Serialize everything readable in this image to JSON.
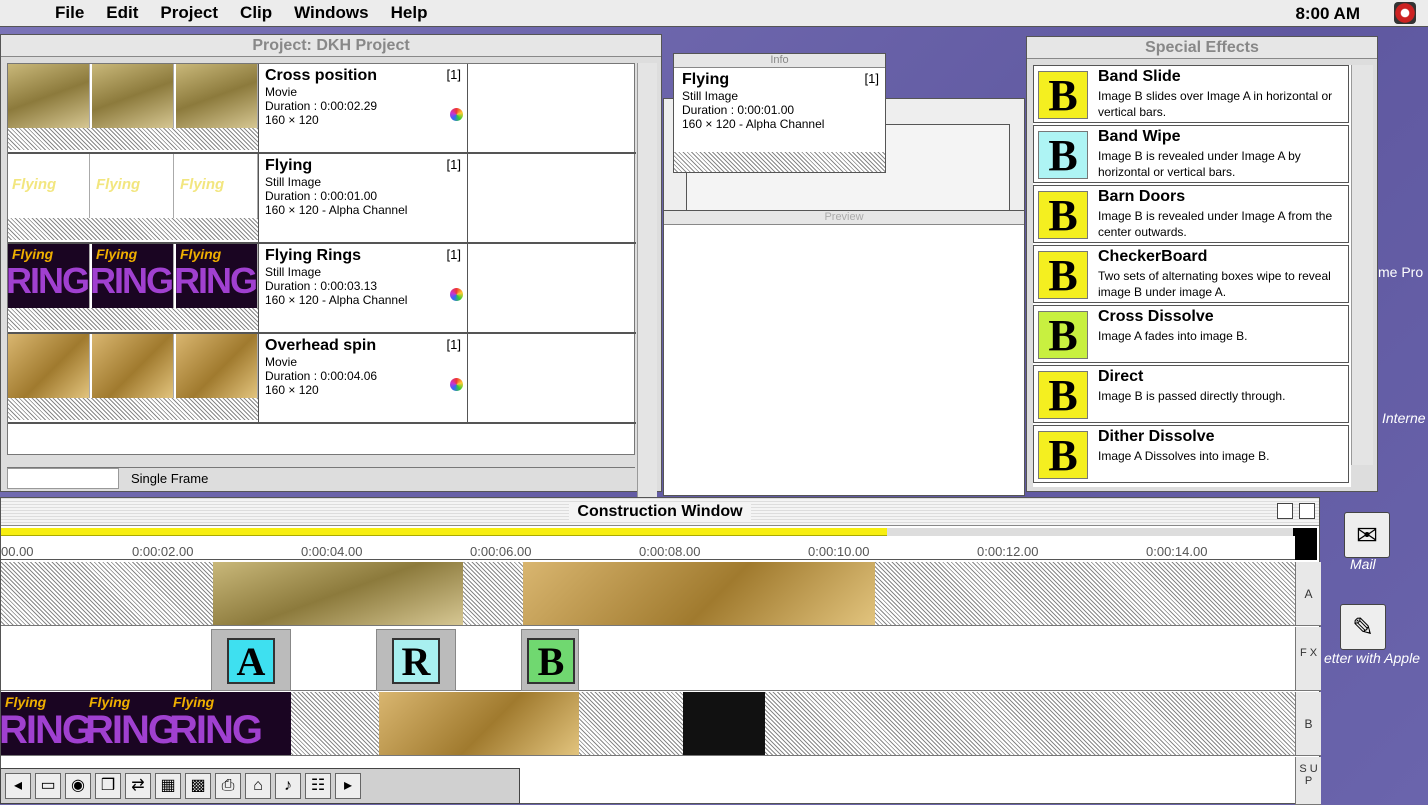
{
  "menubar": {
    "items": [
      "File",
      "Edit",
      "Project",
      "Clip",
      "Windows",
      "Help"
    ],
    "clock": "8:00 AM"
  },
  "project": {
    "title": "Project: DKH Project",
    "footer_label": "Single Frame",
    "rows": [
      {
        "name": "Cross position",
        "count": "[1]",
        "type": "Movie",
        "duration": "Duration : 0:00:02.29",
        "size": "160 × 120"
      },
      {
        "name": "Flying",
        "count": "[1]",
        "type": "Still Image",
        "duration": "Duration : 0:00:01.00",
        "size": "160 × 120 - Alpha Channel"
      },
      {
        "name": "Flying Rings",
        "count": "[1]",
        "type": "Still Image",
        "duration": "Duration : 0:00:03.13",
        "size": "160 × 120 - Alpha Channel"
      },
      {
        "name": "Overhead spin",
        "count": "[1]",
        "type": "Movie",
        "duration": "Duration : 0:00:04.06",
        "size": "160 × 120"
      }
    ],
    "thumb_text": {
      "flying": "Flying",
      "ring": "RING"
    }
  },
  "info": {
    "title": "Info",
    "name": "Flying",
    "count": "[1]",
    "type": "Still Image",
    "duration": "Duration : 0:00:01.00",
    "size": "160 × 120 - Alpha Channel"
  },
  "preview": {
    "title": "Preview"
  },
  "effects": {
    "title": "Special Effects",
    "items": [
      {
        "name": "Band Slide",
        "desc": "Image B slides over Image A in horizontal or vertical bars."
      },
      {
        "name": "Band Wipe",
        "desc": "Image B is revealed under Image A by horizontal or vertical bars."
      },
      {
        "name": "Barn Doors",
        "desc": "Image B is revealed under Image A from the center outwards."
      },
      {
        "name": "CheckerBoard",
        "desc": "Two sets of alternating boxes wipe to reveal image B under image A."
      },
      {
        "name": "Cross Dissolve",
        "desc": "Image A fades into image B."
      },
      {
        "name": "Direct",
        "desc": "Image B is passed directly through."
      },
      {
        "name": "Dither Dissolve",
        "desc": "Image A Dissolves into image B."
      }
    ],
    "icon_letter": "B"
  },
  "construction": {
    "title": "Construction Window",
    "ruler": [
      "00.00",
      "0:00:02.00",
      "0:00:04.00",
      "0:00:06.00",
      "0:00:08.00",
      "0:00:10.00",
      "0:00:12.00",
      "0:00:14.00"
    ],
    "tracks": {
      "a": "A",
      "fx": "F X",
      "b": "B",
      "sup": "S U P"
    },
    "fx_letters": [
      "A",
      "R",
      "B"
    ]
  },
  "desktop": {
    "mail": "Mail",
    "letter": "etter with Apple",
    "internet": "Interne",
    "time_pro": "me Pro"
  }
}
